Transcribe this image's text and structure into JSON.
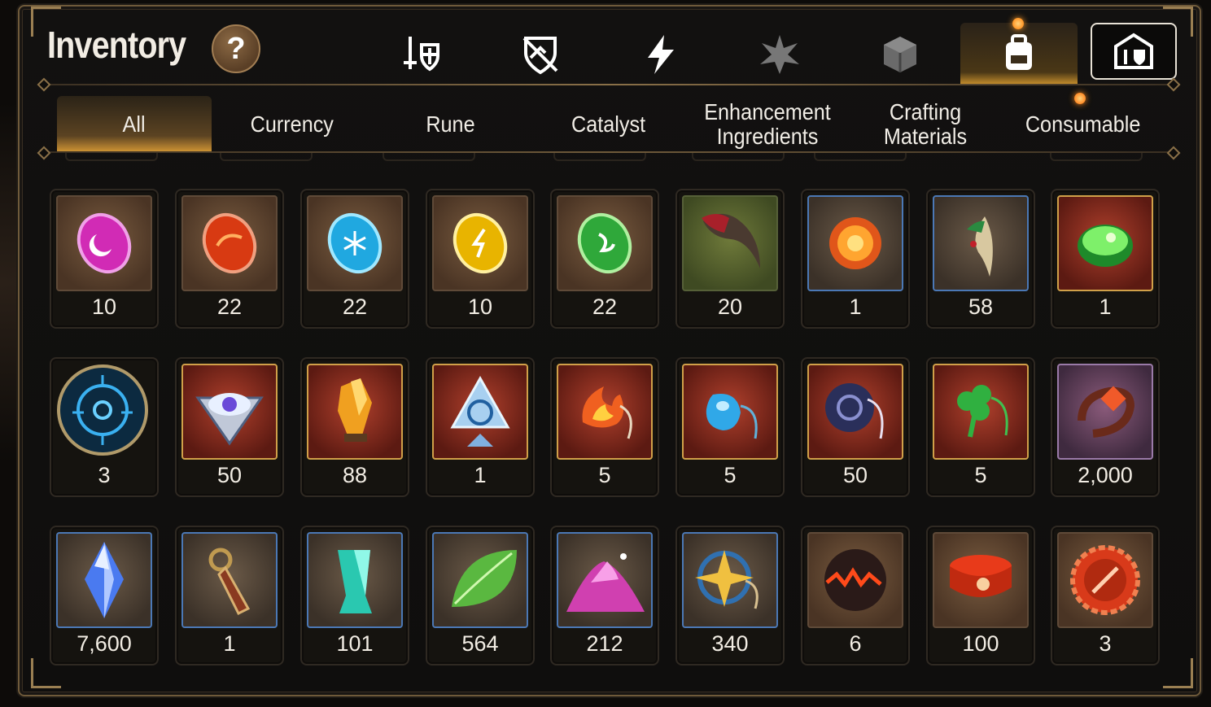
{
  "header": {
    "title": "Inventory",
    "help_label": "?"
  },
  "category_icons": [
    {
      "name": "sword-shield-icon",
      "active": false
    },
    {
      "name": "crossed-shield-icon",
      "active": false
    },
    {
      "name": "lightning-icon",
      "active": false
    },
    {
      "name": "starburst-icon",
      "active": false
    },
    {
      "name": "cube-icon",
      "active": false
    },
    {
      "name": "backpack-icon",
      "active": true
    },
    {
      "name": "armory-icon",
      "active": false
    }
  ],
  "tabs": [
    {
      "label": "All",
      "active": true
    },
    {
      "label": "Currency",
      "active": false
    },
    {
      "label": "Rune",
      "active": false
    },
    {
      "label": "Catalyst",
      "active": false
    },
    {
      "label": "Enhancement Ingredients",
      "active": false
    },
    {
      "label": "Crafting Materials",
      "active": false
    },
    {
      "label": "Consumable",
      "active": false,
      "notification": true
    }
  ],
  "items": [
    {
      "icon": "pink-rune-gem-icon",
      "count": "10"
    },
    {
      "icon": "red-rune-gem-icon",
      "count": "22"
    },
    {
      "icon": "blue-rune-gem-icon",
      "count": "22"
    },
    {
      "icon": "yellow-rune-gem-icon",
      "count": "10"
    },
    {
      "icon": "green-rune-gem-icon",
      "count": "22"
    },
    {
      "icon": "claw-icon",
      "count": "20"
    },
    {
      "icon": "fire-orb-icon",
      "count": "1"
    },
    {
      "icon": "ginseng-root-icon",
      "count": "58"
    },
    {
      "icon": "green-potion-icon",
      "count": "1"
    },
    {
      "icon": "blue-portal-sigil-icon",
      "count": "3"
    },
    {
      "icon": "eye-emblem-icon",
      "count": "50"
    },
    {
      "icon": "orange-crystal-icon",
      "count": "88"
    },
    {
      "icon": "triquetra-crystal-icon",
      "count": "1"
    },
    {
      "icon": "fire-pendant-icon",
      "count": "5"
    },
    {
      "icon": "water-pendant-icon",
      "count": "5"
    },
    {
      "icon": "dark-ring-pendant-icon",
      "count": "50"
    },
    {
      "icon": "clover-pendant-icon",
      "count": "5"
    },
    {
      "icon": "red-ring-icon",
      "count": "2,000"
    },
    {
      "icon": "blue-diamond-icon",
      "count": "7,600"
    },
    {
      "icon": "key-charm-icon",
      "count": "1"
    },
    {
      "icon": "teal-crystal-icon",
      "count": "101"
    },
    {
      "icon": "green-leaf-icon",
      "count": "564"
    },
    {
      "icon": "pink-dust-icon",
      "count": "212"
    },
    {
      "icon": "star-pendant-icon",
      "count": "340"
    },
    {
      "icon": "lava-orb-icon",
      "count": "6"
    },
    {
      "icon": "red-band-icon",
      "count": "100"
    },
    {
      "icon": "red-seal-icon",
      "count": "3"
    }
  ],
  "colors": {
    "accent": "#d89a35",
    "frame": "#6f5a3a",
    "text": "#f2ede4"
  }
}
